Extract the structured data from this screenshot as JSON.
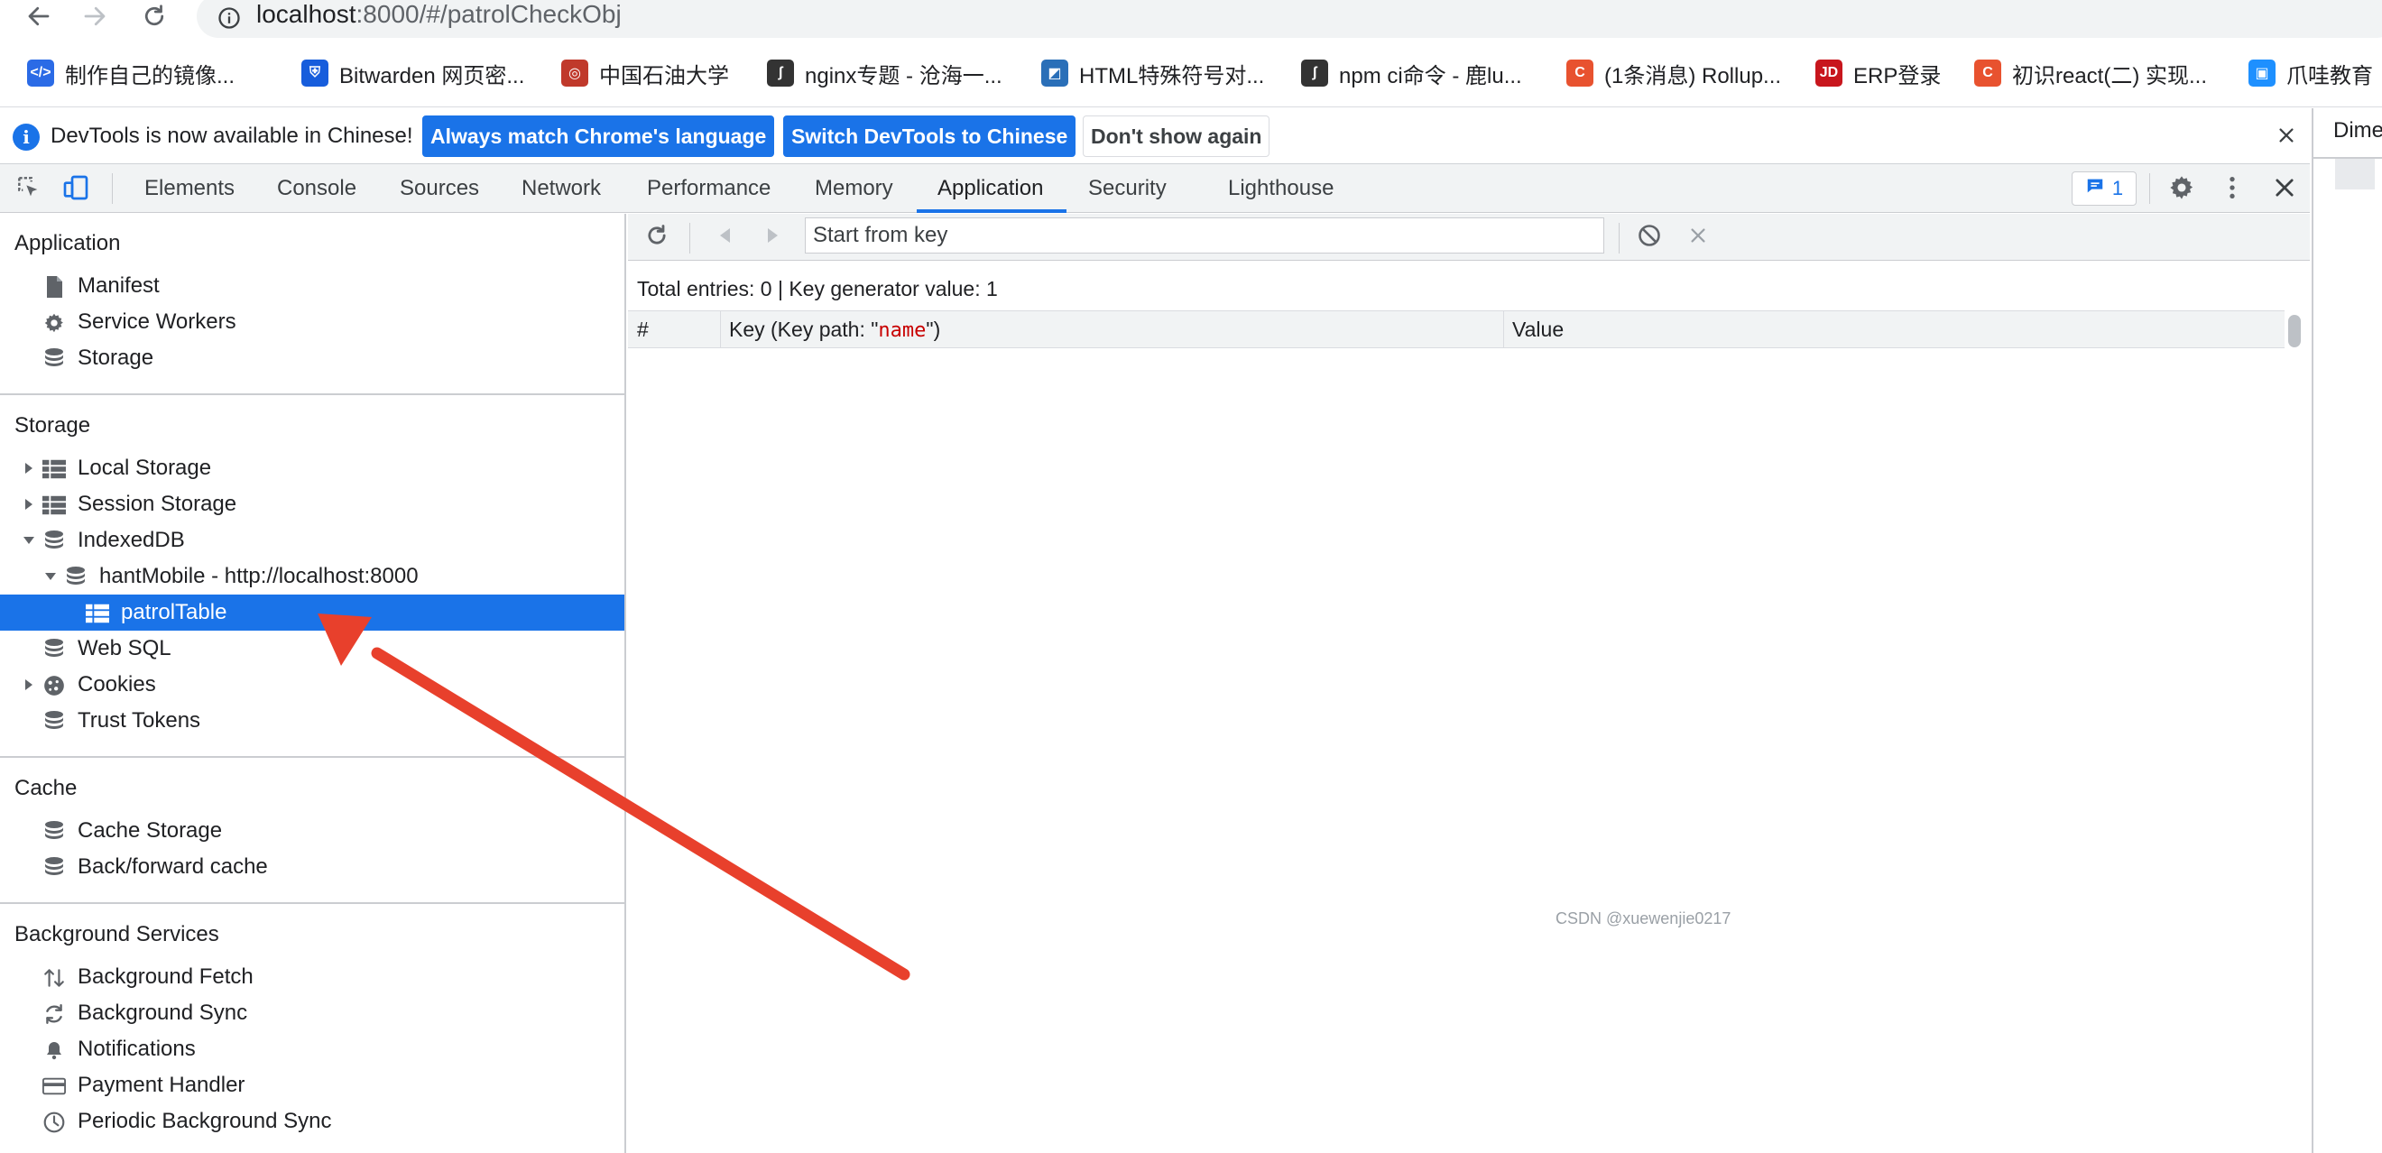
{
  "browser": {
    "url_host": "localhost",
    "url_rest": ":8000/#/patrolCheckObj",
    "bookmarks": [
      {
        "label": "制作自己的镜像...",
        "icon": "devtools-doc-icon",
        "color": "#2b6be6"
      },
      {
        "label": "Bitwarden 网页密...",
        "icon": "bitwarden-icon",
        "color": "#175ddc"
      },
      {
        "label": "中国石油大学",
        "icon": "university-seal-icon",
        "color": "#c0392b"
      },
      {
        "label": "nginx专题 - 沧海一...",
        "icon": "squiggle-logo-icon",
        "color": "#333333"
      },
      {
        "label": "HTML特殊符号对...",
        "icon": "yellow-blue-logo-icon",
        "color": "#2a6fb8"
      },
      {
        "label": "npm ci命令 - 鹿lu...",
        "icon": "squiggle-logo-icon",
        "color": "#333333"
      },
      {
        "label": "(1条消息) Rollup...",
        "icon": "csdn-icon",
        "color": "#e8522f"
      },
      {
        "label": "ERP登录",
        "icon": "jd-icon",
        "color": "#c8161d"
      },
      {
        "label": "初识react(二) 实现...",
        "icon": "csdn-icon",
        "color": "#e8522f"
      },
      {
        "label": "爪哇教育",
        "icon": "bilibili-tv-icon",
        "color": "#1e90ff"
      }
    ]
  },
  "infobar": {
    "message": "DevTools is now available in Chinese!",
    "btn_match": "Always match Chrome's language",
    "btn_switch": "Switch DevTools to Chinese",
    "btn_dismiss": "Don't show again"
  },
  "toolbar": {
    "tabs": [
      "Elements",
      "Console",
      "Sources",
      "Network",
      "Performance",
      "Memory",
      "Application",
      "Security",
      "Lighthouse"
    ],
    "active_tab": "Application",
    "issues_count": "1"
  },
  "sidebar": {
    "application": {
      "title": "Application",
      "items": [
        "Manifest",
        "Service Workers",
        "Storage"
      ]
    },
    "storage": {
      "title": "Storage",
      "items": [
        "Local Storage",
        "Session Storage",
        "IndexedDB",
        "hantMobile - http://localhost:8000",
        "patrolTable",
        "Web SQL",
        "Cookies",
        "Trust Tokens"
      ],
      "selected": "patrolTable"
    },
    "cache": {
      "title": "Cache",
      "items": [
        "Cache Storage",
        "Back/forward cache"
      ]
    },
    "background_services": {
      "title": "Background Services",
      "items": [
        "Background Fetch",
        "Background Sync",
        "Notifications",
        "Payment Handler",
        "Periodic Background Sync"
      ]
    }
  },
  "main": {
    "key_placeholder": "Start from key",
    "summary": "Total entries: 0 | Key generator value: 1",
    "columns": {
      "index": "#",
      "key_prefix": "Key (Key path: \"",
      "key_path": "name",
      "key_suffix": "\")",
      "value": "Value"
    }
  },
  "right_panel": {
    "label": "Dime"
  },
  "watermark": "CSDN @xuewenjie0217",
  "colors": {
    "accent": "#1a73e8",
    "annotation_arrow": "#e8402c",
    "key_path_red": "#c80000"
  }
}
